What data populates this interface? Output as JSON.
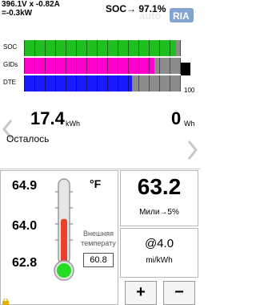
{
  "header": {
    "line1": "396.1V x -0.82A",
    "line2": "=-0.3kW",
    "soc_label": "SOC→ 97.1%",
    "watermark": "auto RIA"
  },
  "bars": {
    "items": [
      {
        "label": "SOC",
        "fraction": 0.97,
        "color": "#1fbf1f"
      },
      {
        "label": "GIDs",
        "fraction": 0.83,
        "color": "#ff00cc"
      },
      {
        "label": "DTE",
        "fraction": 0.69,
        "color": "#1a1aff"
      }
    ],
    "max_label": "100"
  },
  "energy": {
    "remaining_value": "17.4",
    "remaining_unit": "kWh",
    "right_value": "0",
    "right_unit": "Wh",
    "remaining_label": "Осталось"
  },
  "temperature": {
    "ticks": [
      "64.9",
      "64.0",
      "62.8"
    ],
    "unit": "°F",
    "external_label": "Внешняя температу",
    "external_value": "60.8",
    "level": 0.55
  },
  "range": {
    "value": "63.2",
    "label": "Мили→5%"
  },
  "efficiency": {
    "value": "@4.0",
    "unit": "mi/kWh"
  },
  "controls": {
    "plus": "+",
    "minus": "−"
  },
  "colors": {
    "soc": "#1fbf1f",
    "gids": "#ff00cc",
    "dte": "#1a1aff",
    "track": "#8c8c8c",
    "mercury": "#e8412c",
    "bulb": "#22dd22"
  }
}
